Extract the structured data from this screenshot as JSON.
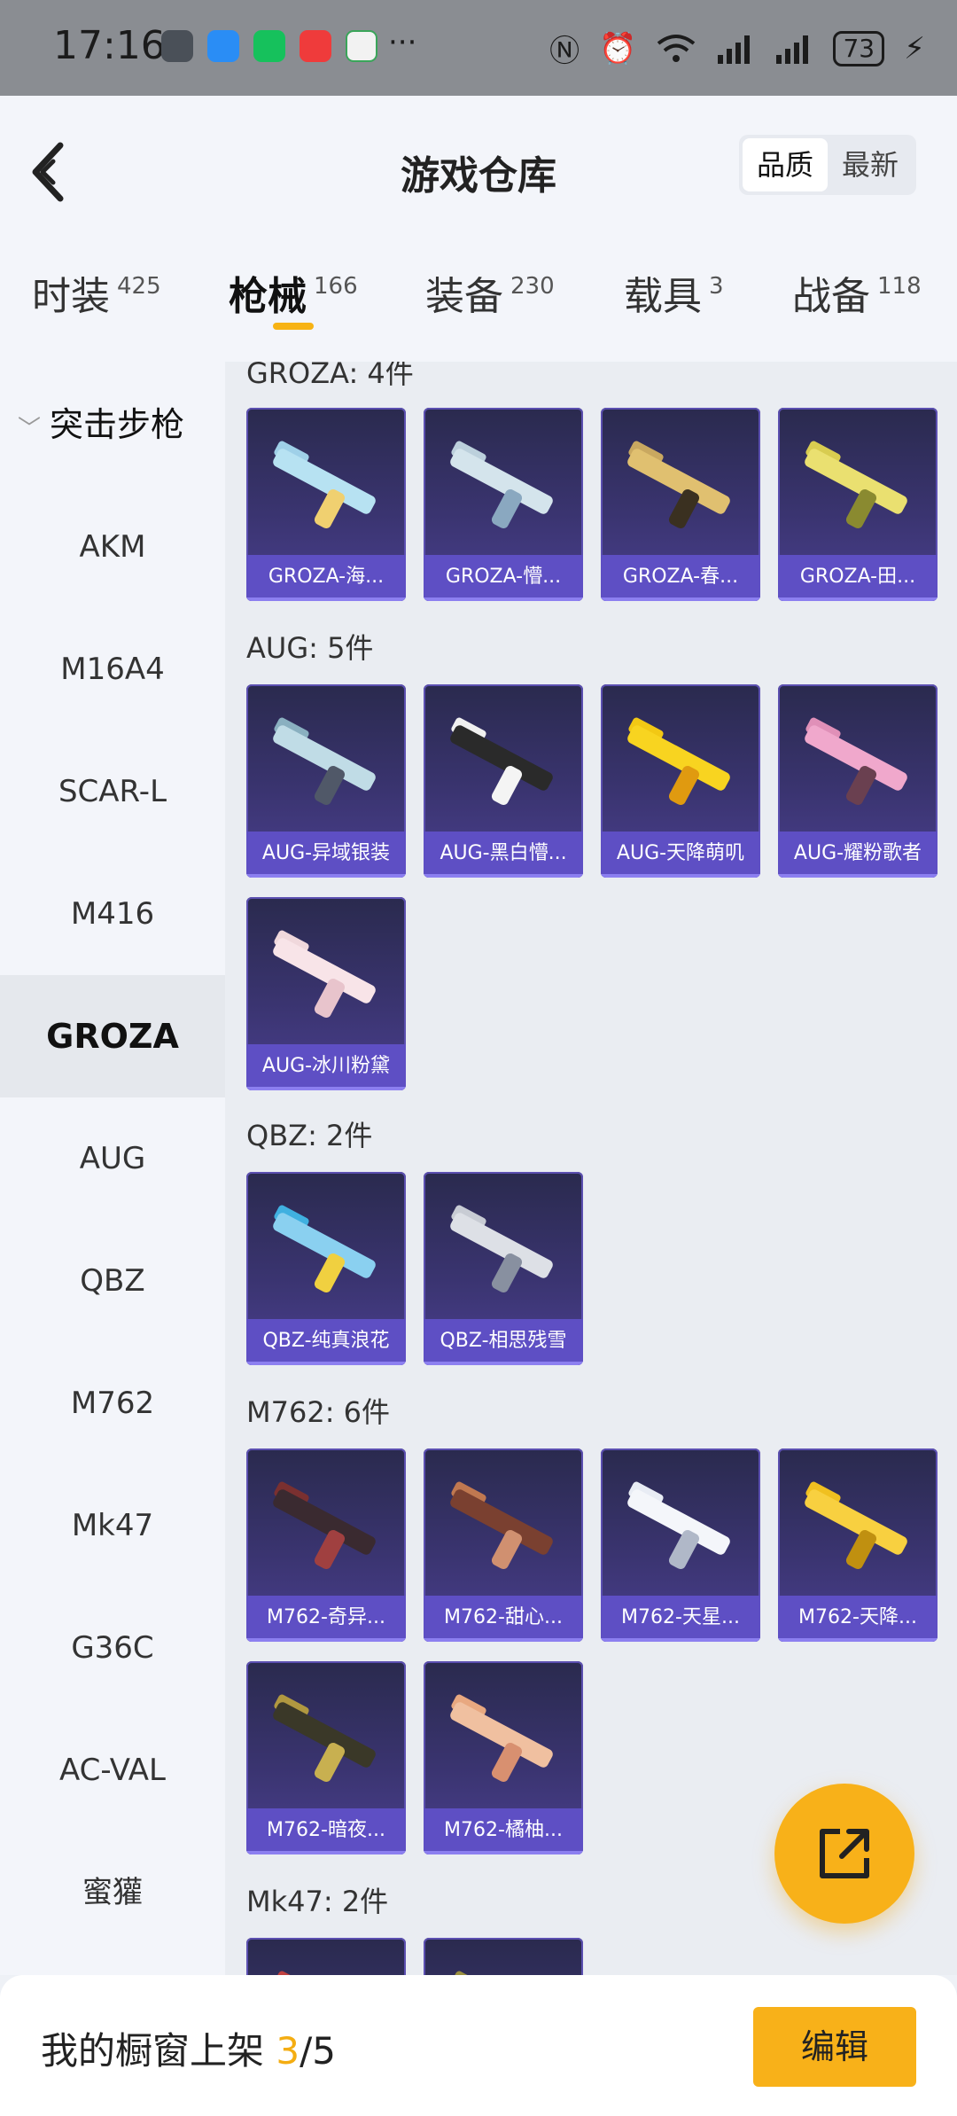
{
  "status_bar": {
    "time": "17:16",
    "more": "···",
    "battery": "73"
  },
  "header": {
    "title": "游戏仓库",
    "sort": [
      "品质",
      "最新"
    ],
    "active_sort": 0
  },
  "tabs": [
    {
      "label": "时装",
      "count": "425"
    },
    {
      "label": "枪械",
      "count": "166"
    },
    {
      "label": "装备",
      "count": "230"
    },
    {
      "label": "载具",
      "count": "3"
    },
    {
      "label": "战备",
      "count": "118"
    }
  ],
  "sidebar": {
    "group": "突击步枪",
    "items": [
      "AKM",
      "M16A4",
      "SCAR-L",
      "M416",
      "GROZA",
      "AUG",
      "QBZ",
      "M762",
      "Mk47",
      "G36C",
      "AC-VAL",
      "蜜獾"
    ],
    "active_index": 4
  },
  "sections": [
    {
      "title": "GROZA: 4件",
      "items": [
        "GROZA-海...",
        "GROZA-懵...",
        "GROZA-春...",
        "GROZA-田..."
      ]
    },
    {
      "title": "AUG: 5件",
      "items": [
        "AUG-异域银装",
        "AUG-黑白懵...",
        "AUG-天降萌叽",
        "AUG-耀粉歌者",
        "AUG-冰川粉黛"
      ]
    },
    {
      "title": "QBZ: 2件",
      "items": [
        "QBZ-纯真浪花",
        "QBZ-相思残雪"
      ]
    },
    {
      "title": "M762: 6件",
      "items": [
        "M762-奇异...",
        "M762-甜心...",
        "M762-天星...",
        "M762-天降...",
        "M762-暗夜...",
        "M762-橘柚..."
      ]
    },
    {
      "title": "Mk47: 2件",
      "items": [
        "",
        ""
      ]
    }
  ],
  "bottom_bar": {
    "label": "我的橱窗上架",
    "current": "3",
    "separator": "/",
    "total": "5",
    "edit": "编辑"
  },
  "colors": {
    "accent": "#f8b119",
    "card_bar": "#5e4fc4"
  }
}
